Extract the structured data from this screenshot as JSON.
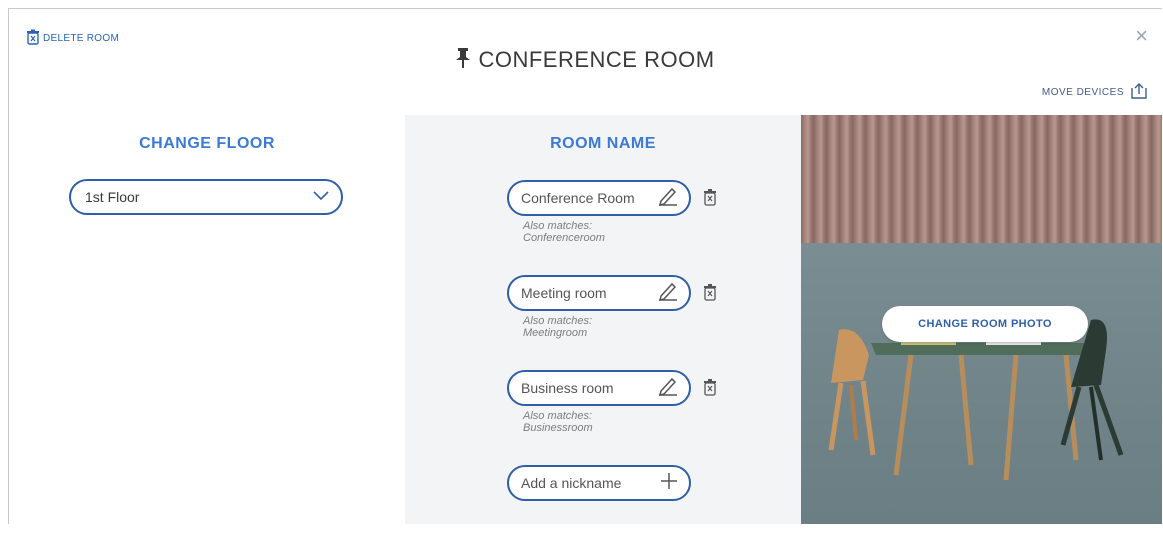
{
  "header": {
    "delete_room_label": "DELETE ROOM",
    "title": "CONFERENCE ROOM",
    "move_devices_label": "MOVE DEVICES",
    "close_glyph": "×"
  },
  "floor": {
    "title": "CHANGE FLOOR",
    "selected": "1st Floor"
  },
  "room_name": {
    "title": "ROOM NAME",
    "nicknames": [
      {
        "value": "Conference Room",
        "also_label": "Also matches:",
        "also_value": "Conferenceroom"
      },
      {
        "value": "Meeting room",
        "also_label": "Also matches:",
        "also_value": "Meetingroom"
      },
      {
        "value": "Business room",
        "also_label": "Also matches:",
        "also_value": "Businessroom"
      }
    ],
    "add_label": "Add a nickname"
  },
  "photo": {
    "change_label": "CHANGE ROOM PHOTO"
  },
  "colors": {
    "accent": "#2f5fa8",
    "title_blue": "#3b7ad6",
    "panel_bg": "#f3f4f6"
  }
}
